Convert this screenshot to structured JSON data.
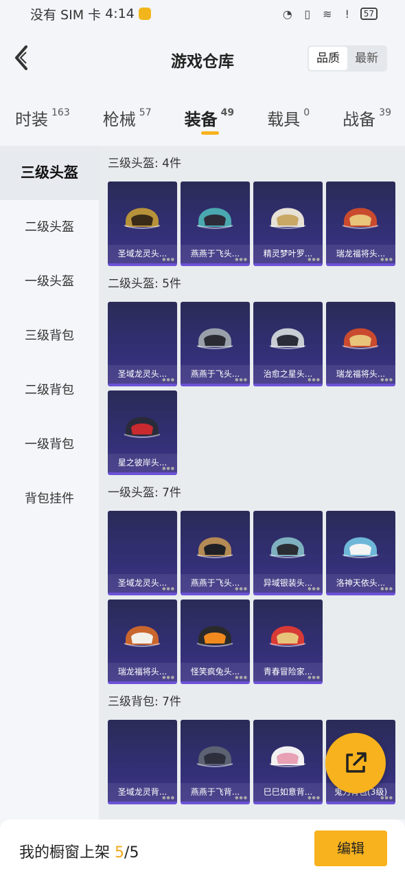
{
  "status_bar": {
    "carrier": "没有 SIM 卡",
    "time": "4:14",
    "battery": "57"
  },
  "header": {
    "title": "游戏仓库",
    "sort_options": [
      "品质",
      "最新"
    ],
    "sort_active": "品质"
  },
  "tabs": [
    {
      "label": "时装",
      "count": "163"
    },
    {
      "label": "枪械",
      "count": "57"
    },
    {
      "label": "装备",
      "count": "49",
      "active": true
    },
    {
      "label": "载具",
      "count": "0"
    },
    {
      "label": "战备",
      "count": "39"
    }
  ],
  "sidebar": {
    "items": [
      "三级头盔",
      "二级头盔",
      "一级头盔",
      "三级背包",
      "二级背包",
      "一级背包",
      "背包挂件"
    ],
    "active": "三级头盔"
  },
  "sections": [
    {
      "title": "三级头盔: 4件",
      "items": [
        "圣域龙灵头...",
        "燕燕于飞头...",
        "精灵梦叶罗...",
        "瑞龙福将头..."
      ]
    },
    {
      "title": "二级头盔: 5件",
      "items": [
        "圣域龙灵头...",
        "燕燕于飞头...",
        "治愈之星头...",
        "瑞龙福将头...",
        "星之彼岸头..."
      ]
    },
    {
      "title": "一级头盔: 7件",
      "items": [
        "圣域龙灵头...",
        "燕燕于飞头...",
        "异域银装头...",
        "洛神天依头...",
        "瑞龙福将头...",
        "怪笑疯兔头...",
        "青春冒险家..."
      ]
    },
    {
      "title": "三级背包: 7件",
      "items": [
        "圣域龙灵背...",
        "燕燕于飞背...",
        "巳巳如意背...",
        "鬼刀背包(3级)"
      ]
    }
  ],
  "bottom_bar": {
    "label": "我的橱窗上架",
    "current": "5",
    "separator": "/",
    "total": "5",
    "edit_label": "编辑"
  },
  "colors": {
    "accent": "#f7b21d",
    "card_bg": "#322f74",
    "card_border": "#6c52d6"
  }
}
